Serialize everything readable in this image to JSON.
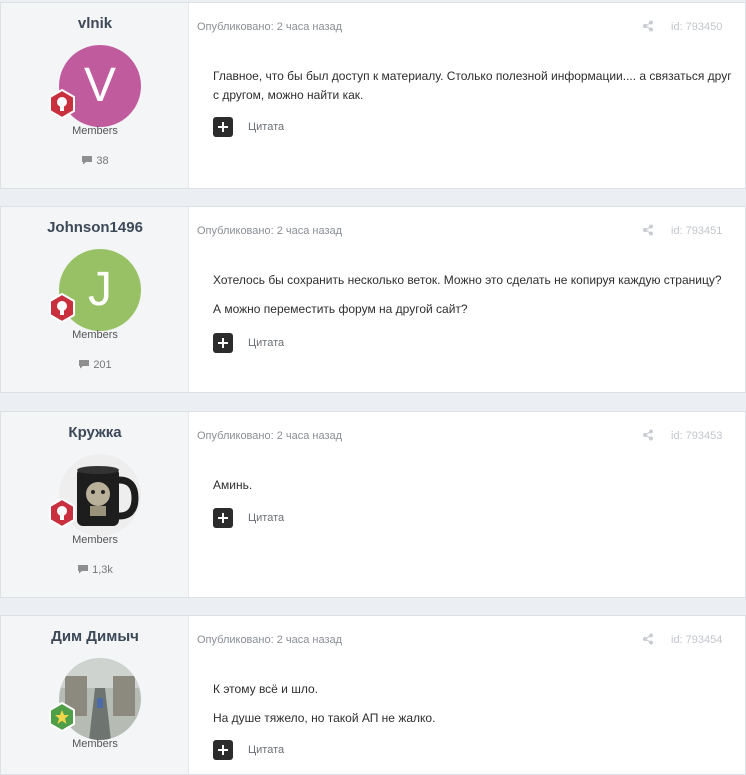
{
  "posts": [
    {
      "author": "vlnik",
      "avatar_letter": "V",
      "avatar_color": "#c05c9e",
      "badge": "bulb-badge",
      "group": "Members",
      "post_count": "38",
      "meta": "Опубликовано: 2 часа назад",
      "post_id": "id: 793450",
      "paragraphs": [
        "Главное, что бы был доступ к материалу. Столько полезной информации....  а связаться друг с другом, можно найти как."
      ],
      "quote_label": "Цитата"
    },
    {
      "author": "Johnson1496",
      "avatar_letter": "J",
      "avatar_color": "#98c166",
      "badge": "bulb-badge",
      "group": "Members",
      "post_count": "201",
      "meta": "Опубликовано: 2 часа назад",
      "post_id": "id: 793451",
      "paragraphs": [
        "Хотелось бы сохранить несколько веток. Можно это сделать не копируя каждую страницу?",
        "А можно переместить форум на другой сайт?"
      ],
      "quote_label": "Цитата"
    },
    {
      "author": "Кружка",
      "avatar_letter": "",
      "avatar_color": "#e9e9e9",
      "badge": "bulb-badge",
      "group": "Members",
      "post_count": "1,3k",
      "meta": "Опубликовано: 2 часа назад",
      "post_id": "id: 793453",
      "paragraphs": [
        "Аминь."
      ],
      "quote_label": "Цитата"
    },
    {
      "author": "Дим Димыч",
      "avatar_letter": "",
      "avatar_color": "#a9b0a6",
      "badge": "star-badge",
      "group": "Members",
      "post_count": "",
      "meta": "Опубликовано: 2 часа назад",
      "post_id": "id: 793454",
      "paragraphs": [
        "К этому всё и шло.",
        "На душе тяжело, но такой АП не жалко."
      ],
      "quote_label": "Цитата"
    }
  ],
  "colors": {
    "accent_badge": "#c8303e",
    "star_badge": "#4f9e48",
    "sidebar_bg": "#f3f5f7",
    "page_bg": "#ebeef2"
  },
  "icons": {
    "share": "share-icon",
    "comment": "comment-icon",
    "quote": "plus-icon"
  }
}
